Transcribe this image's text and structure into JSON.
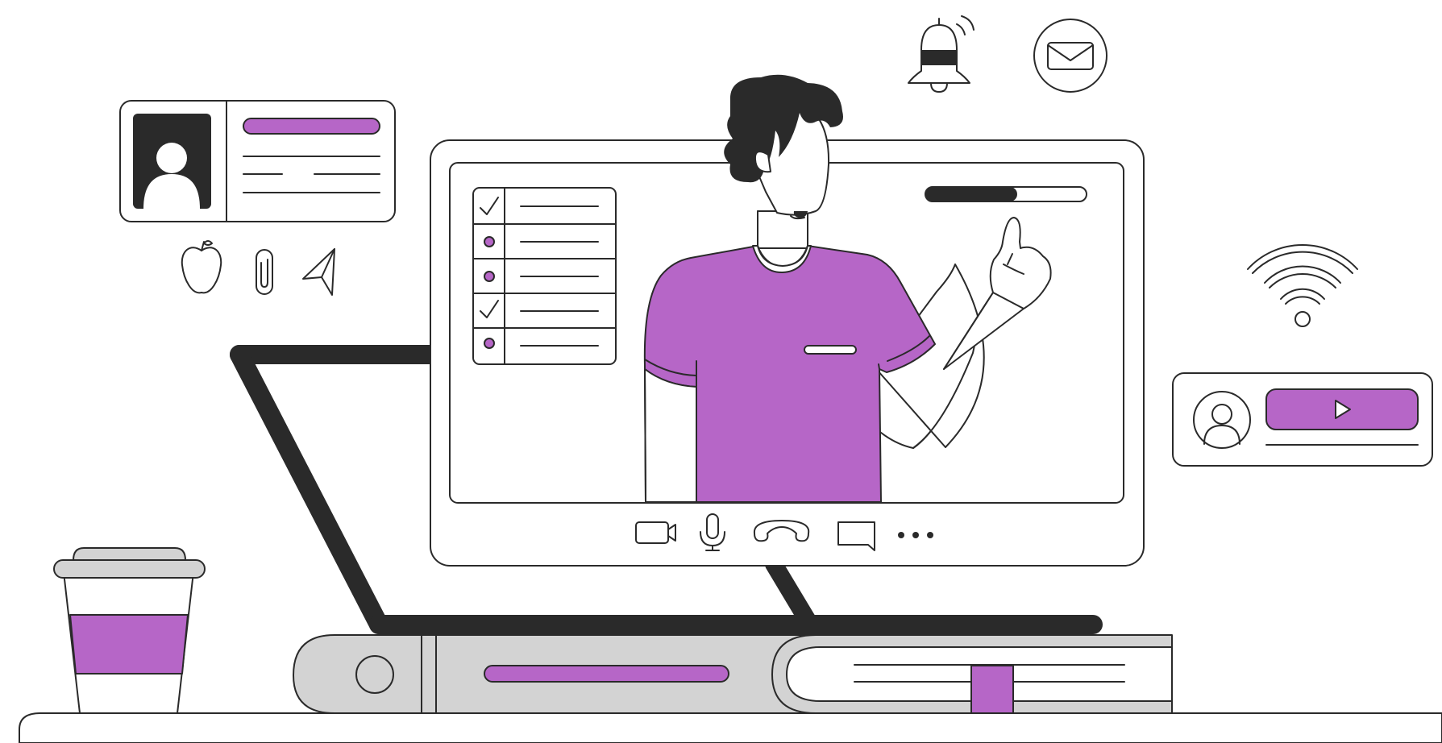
{
  "palette": {
    "accent": "#b666c7",
    "ink": "#2a2a2a",
    "grey": "#d3d3d3",
    "paper": "#ffffff"
  },
  "video_call": {
    "toolbar_icons": [
      "camera-icon",
      "microphone-icon",
      "hang-up-icon",
      "chat-icon",
      "more-options-icon"
    ],
    "progress_fraction": 0.57,
    "checklist_states": [
      "checked",
      "bullet",
      "bullet",
      "checked",
      "bullet"
    ]
  },
  "profile_card": {
    "icons": [
      "avatar-icon"
    ]
  },
  "small_icons": [
    "apple-icon",
    "paperclip-icon",
    "paper-plane-icon"
  ],
  "notification_icons": [
    "bell-icon",
    "mail-icon"
  ],
  "wifi_icon": "wifi-icon",
  "media_card": {
    "icons": [
      "user-avatar-icon",
      "play-icon"
    ]
  },
  "desk_items": [
    "coffee-cup",
    "book-stack",
    "bookmark"
  ]
}
